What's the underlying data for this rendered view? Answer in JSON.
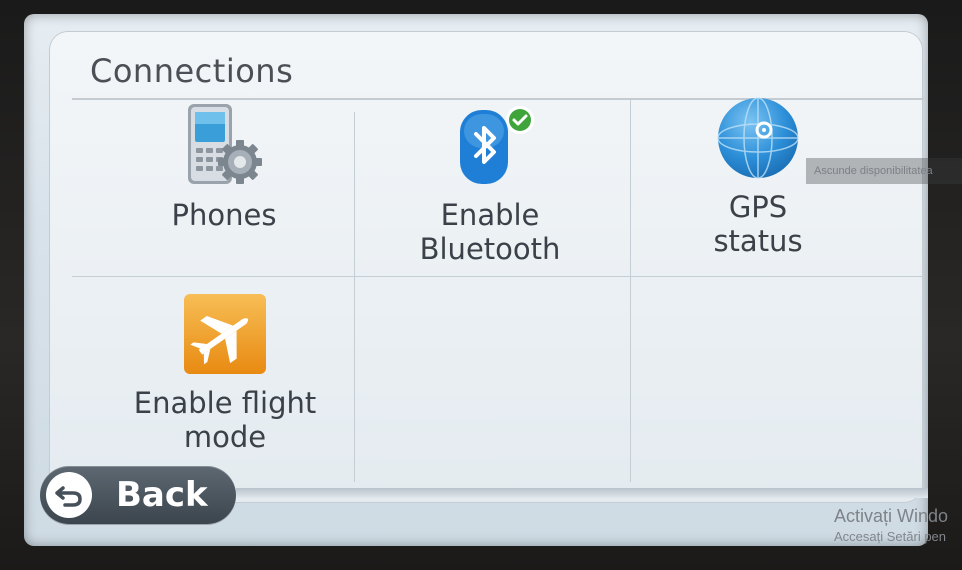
{
  "screen": {
    "title": "Connections"
  },
  "tiles": [
    {
      "id": "phones",
      "label": "Phones",
      "icon": "phone-gear-icon"
    },
    {
      "id": "bluetooth",
      "label_line1": "Enable",
      "label_line2": "Bluetooth",
      "icon": "bluetooth-icon",
      "badge": "check-badge-icon"
    },
    {
      "id": "gps",
      "label_line1": "GPS",
      "label_line2": "status",
      "icon": "globe-icon"
    },
    {
      "id": "flight",
      "label_line1": "Enable flight",
      "label_line2": "mode",
      "icon": "airplane-icon"
    }
  ],
  "footer": {
    "back_label": "Back",
    "back_icon": "back-arrow-icon"
  },
  "overlay": {
    "tooltip_text": "Ascunde disponibilitatea",
    "watermark_line1": "Activați Windo",
    "watermark_line2": "Accesați Setări pen"
  },
  "colors": {
    "title_text": "#4a5056",
    "bluetooth_blue": "#1f7fd6",
    "check_green": "#3fa53a",
    "flight_orange": "#f2a12b",
    "gps_blue": "#2c8fd8",
    "back_button": "#46505a"
  }
}
